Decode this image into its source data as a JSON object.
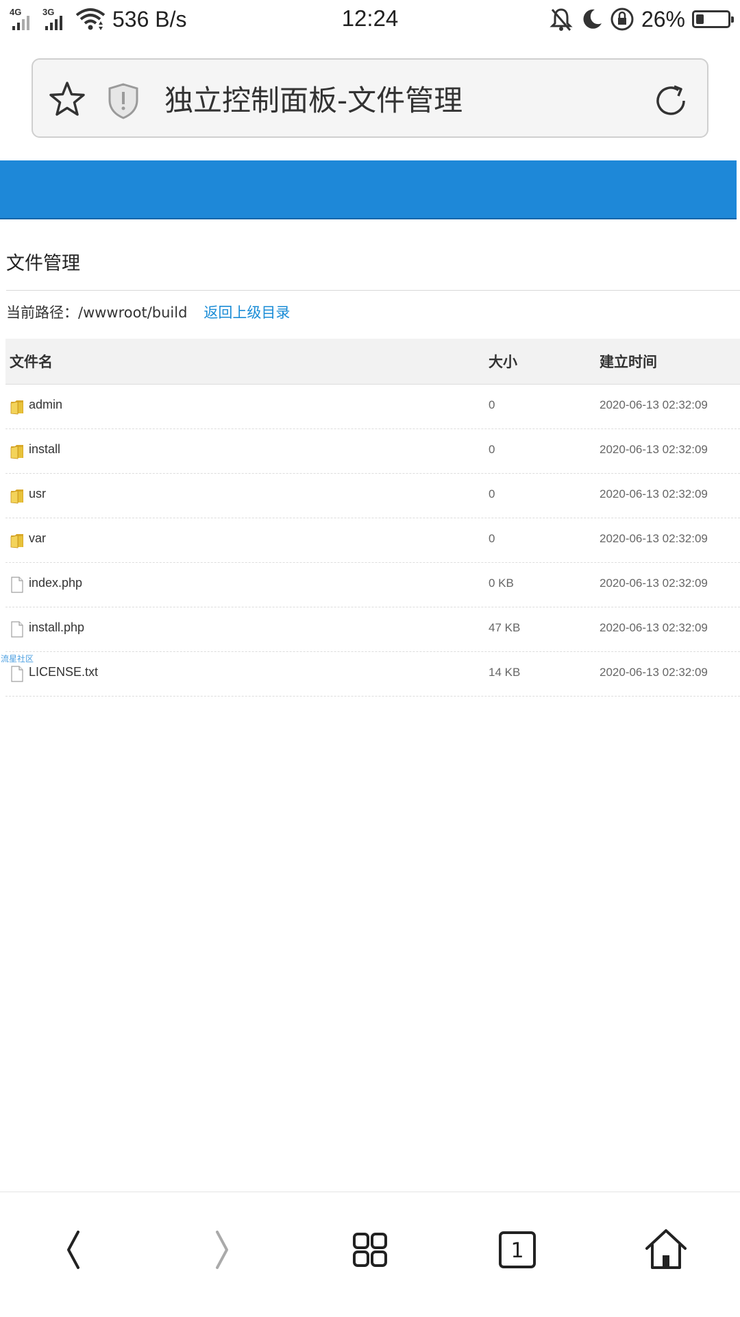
{
  "status_bar": {
    "signal1_label": "4G",
    "signal2_label": "3G",
    "net_speed": "536 B/s",
    "time": "12:24",
    "battery_percent": "26%",
    "battery_level": 0.26,
    "icons": [
      "wifi-icon",
      "mute-icon",
      "moon-icon",
      "rotation-lock-icon",
      "battery-icon"
    ]
  },
  "address_bar": {
    "title": "独立控制面板-文件管理",
    "icons": [
      "star-icon",
      "shield-icon",
      "reload-icon"
    ]
  },
  "page": {
    "heading": "文件管理",
    "path_label": "当前路径：/wwwroot/build",
    "back_link": "返回上级目录",
    "watermark": "流星社区"
  },
  "table": {
    "headers": {
      "name": "文件名",
      "size": "大小",
      "date": "建立时间"
    },
    "rows": [
      {
        "type": "folder",
        "name": "admin",
        "size": "0",
        "date": "2020-06-13 02:32:09"
      },
      {
        "type": "folder",
        "name": "install",
        "size": "0",
        "date": "2020-06-13 02:32:09"
      },
      {
        "type": "folder",
        "name": "usr",
        "size": "0",
        "date": "2020-06-13 02:32:09"
      },
      {
        "type": "folder",
        "name": "var",
        "size": "0",
        "date": "2020-06-13 02:32:09"
      },
      {
        "type": "file",
        "name": "index.php",
        "size": "0 KB",
        "date": "2020-06-13 02:32:09"
      },
      {
        "type": "file",
        "name": "install.php",
        "size": "47 KB",
        "date": "2020-06-13 02:32:09"
      },
      {
        "type": "file",
        "name": "LICENSE.txt",
        "size": "14 KB",
        "date": "2020-06-13 02:32:09"
      }
    ]
  },
  "bottom_nav": {
    "tab_count": "1",
    "icons": [
      "back-icon",
      "forward-icon",
      "menu-grid-icon",
      "tabs-icon",
      "home-icon"
    ]
  },
  "colors": {
    "header_blue": "#1e88d8",
    "link_blue": "#1a8cd6",
    "folder_yellow": "#e8c23a"
  }
}
